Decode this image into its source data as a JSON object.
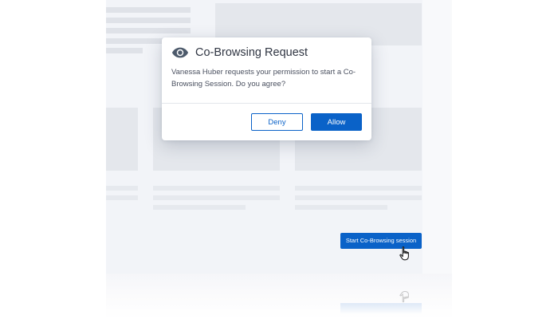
{
  "dialog": {
    "title": "Co-Browsing Request",
    "message": "Vanessa Huber requests your permission to start a Co-Browsing Session. Do you agree?",
    "deny_label": "Deny",
    "allow_label": "Allow",
    "icon": "eye-icon"
  },
  "page": {
    "start_button_label": "Start Co-Browsing session",
    "cursor_icon": "hand-pointer-icon"
  },
  "colors": {
    "primary": "#0a62c8",
    "page_background": "#f2f4f8",
    "skeleton": "#dfe2e8",
    "title_text": "#2f3542",
    "body_text": "#4b5160"
  }
}
